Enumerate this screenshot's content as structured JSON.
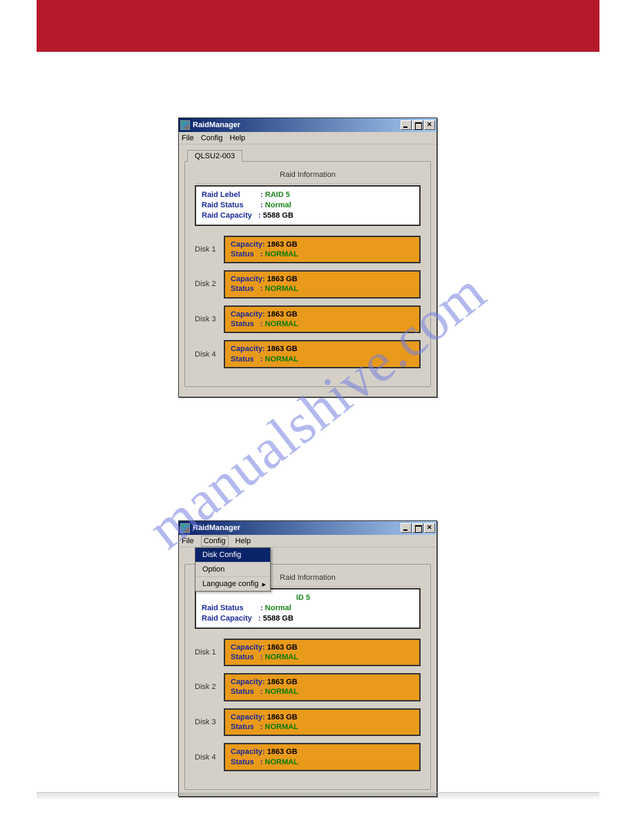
{
  "watermark": "manualshive.com",
  "window": {
    "title": "RaidManager",
    "menu": {
      "file": "File",
      "config": "Config",
      "help": "Help"
    },
    "tab": "QLSU2-003"
  },
  "raid_header": "Raid Information",
  "raid_info": {
    "level_label": "Raid Lebel",
    "level_value": "RAID 5",
    "status_label": "Raid Status",
    "status_value": "Normal",
    "capacity_label": "Raid Capacity",
    "capacity_value": "5588 GB"
  },
  "disk_labels": {
    "capacity": "Capacity",
    "status": "Status"
  },
  "disks": [
    {
      "name": "Disk 1",
      "capacity": "1863 GB",
      "status": "NORMAL"
    },
    {
      "name": "Disk 2",
      "capacity": "1863 GB",
      "status": "NORMAL"
    },
    {
      "name": "Disk 3",
      "capacity": "1863 GB",
      "status": "NORMAL"
    },
    {
      "name": "Disk 4",
      "capacity": "1863 GB",
      "status": "NORMAL"
    }
  ],
  "dropdown": {
    "disk_config": "Disk Config",
    "option": "Option",
    "language_config": "Language config"
  }
}
